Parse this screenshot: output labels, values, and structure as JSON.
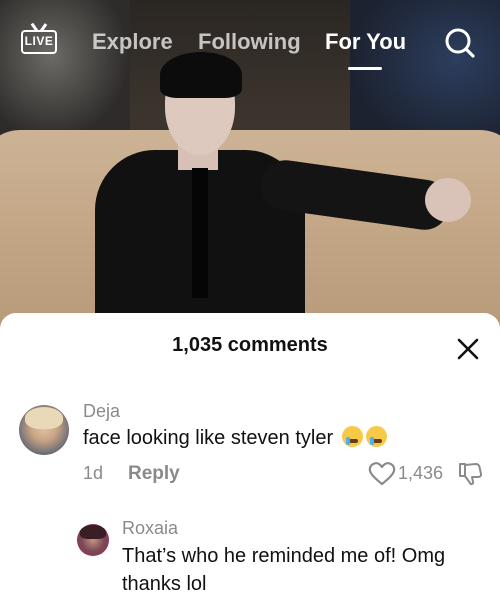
{
  "nav": {
    "live_label": "LIVE",
    "tabs": [
      {
        "label": "Explore"
      },
      {
        "label": "Following"
      },
      {
        "label": "For You"
      }
    ],
    "search_icon": "search-icon"
  },
  "comments_sheet": {
    "title": "1,035 comments",
    "close_icon": "close-icon",
    "comments": [
      {
        "username": "Deja",
        "text": "face looking like steven tyler",
        "emojis": [
          "loudly-crying-face",
          "loudly-crying-face"
        ],
        "age": "1d",
        "reply_label": "Reply",
        "like_count": "1,436",
        "like_icon": "heart-outline-icon",
        "dislike_icon": "thumbs-down-icon"
      },
      {
        "username": "Roxaia",
        "text": "That’s who he reminded me of! Omg thanks lol"
      }
    ]
  }
}
